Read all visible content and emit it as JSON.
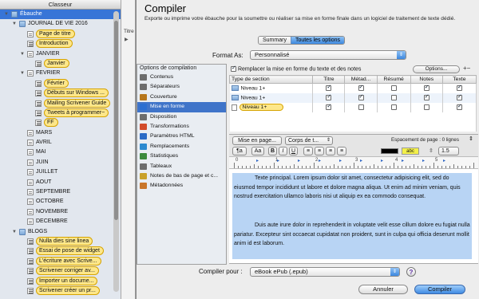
{
  "binder": {
    "header": "Classeur",
    "items": [
      {
        "label": "Ébauche",
        "level": 0,
        "icon": "folder",
        "expanded": true,
        "selected": true
      },
      {
        "label": "JOURNAL DE VIE 2016",
        "level": 1,
        "icon": "folder",
        "expanded": true
      },
      {
        "label": "Page de titre",
        "level": 2,
        "icon": "doc",
        "highlighted": true
      },
      {
        "label": "Introduction",
        "level": 2,
        "icon": "doctxt",
        "highlighted": true
      },
      {
        "label": "JANVIER",
        "level": 2,
        "icon": "doc",
        "expanded": true
      },
      {
        "label": "Janvier",
        "level": 3,
        "icon": "doctxt",
        "highlighted": true
      },
      {
        "label": "FEVRIER",
        "level": 2,
        "icon": "doc",
        "expanded": true
      },
      {
        "label": "Février",
        "level": 3,
        "icon": "doctxt",
        "highlighted": true
      },
      {
        "label": "Débuts sur Windows ...",
        "level": 3,
        "icon": "doctxt",
        "highlighted": true
      },
      {
        "label": "Mailing Scrivener Guide",
        "level": 3,
        "icon": "doctxt",
        "highlighted": true
      },
      {
        "label": "Tweets à programmer~",
        "level": 3,
        "icon": "doctxt",
        "highlighted": true
      },
      {
        "label": "FF",
        "level": 3,
        "icon": "doctxt",
        "highlighted": true
      },
      {
        "label": "MARS",
        "level": 2,
        "icon": "doc"
      },
      {
        "label": "AVRIL",
        "level": 2,
        "icon": "doc"
      },
      {
        "label": "MAI",
        "level": 2,
        "icon": "doc"
      },
      {
        "label": "JUIN",
        "level": 2,
        "icon": "doc"
      },
      {
        "label": "JUILLET",
        "level": 2,
        "icon": "doc"
      },
      {
        "label": "AOUT",
        "level": 2,
        "icon": "doc"
      },
      {
        "label": "SEPTEMBRE",
        "level": 2,
        "icon": "doc"
      },
      {
        "label": "OCTOBRE",
        "level": 2,
        "icon": "doc"
      },
      {
        "label": "NOVEMBRE",
        "level": 2,
        "icon": "doc"
      },
      {
        "label": "DECEMBRE",
        "level": 2,
        "icon": "doc"
      },
      {
        "label": "BLOGS",
        "level": 1,
        "icon": "folder",
        "expanded": true
      },
      {
        "label": "Nulla dies sine linea",
        "level": 2,
        "icon": "doctxt",
        "highlighted": true
      },
      {
        "label": "Essai de pose de widget",
        "level": 2,
        "icon": "doctxt",
        "highlighted": true
      },
      {
        "label": "L'écriture avec Scrive...",
        "level": 2,
        "icon": "doctxt",
        "highlighted": true
      },
      {
        "label": "Scrivener corriger av...",
        "level": 2,
        "icon": "doctxt",
        "highlighted": true
      },
      {
        "label": "Importer un docume...",
        "level": 2,
        "icon": "doctxt",
        "highlighted": true
      },
      {
        "label": "Scrivener créer un pr...",
        "level": 2,
        "icon": "doctxt",
        "highlighted": true
      }
    ]
  },
  "editor_strip": {
    "tab_label": "Titre"
  },
  "dialog": {
    "title": "Compiler",
    "subtitle": "Exporte ou imprime votre ébauche pour la soumettre ou réaliser sa mise en forme finale dans un logiciel de traitement de texte dédié.",
    "tabs": [
      "Summary",
      "Toutes les options"
    ],
    "active_tab": 1,
    "format_label": "Format As:",
    "format_value": "Personnalisé",
    "options_header": "Options de compilation",
    "options": [
      {
        "label": "Contenus",
        "icon": "contents-icon",
        "color": "#6d6d6d"
      },
      {
        "label": "Séparateurs",
        "icon": "separators-icon",
        "color": "#6d6d6d"
      },
      {
        "label": "Couverture",
        "icon": "cover-icon",
        "color": "#b7771c"
      },
      {
        "label": "Mise en forme",
        "icon": "formatting-icon",
        "color": "#2c6fd1",
        "selected": true
      },
      {
        "label": "Disposition",
        "icon": "layout-icon",
        "color": "#6d6d6d"
      },
      {
        "label": "Transformations",
        "icon": "transformations-icon",
        "color": "#d24b2b"
      },
      {
        "label": "Paramètres HTML",
        "icon": "html-settings-icon",
        "color": "#2b6bc6"
      },
      {
        "label": "Remplacements",
        "icon": "replacements-icon",
        "color": "#2c8ad0"
      },
      {
        "label": "Statistiques",
        "icon": "statistics-icon",
        "color": "#3c8a3c"
      },
      {
        "label": "Tableaux",
        "icon": "tables-icon",
        "color": "#6d6d6d"
      },
      {
        "label": "Notes de bas de page et c...",
        "icon": "footnotes-icon",
        "color": "#c9a12a"
      },
      {
        "label": "Métadonnées",
        "icon": "metadata-icon",
        "color": "#c9762a"
      }
    ],
    "override_label": "Remplacer la mise en forme du texte et des notes",
    "override_checked": true,
    "options_button": "Options...",
    "columns": [
      "Type de section",
      "Titre",
      "Métad...",
      "Résumé",
      "Notes",
      "Texte"
    ],
    "rows": [
      {
        "name": "Niveau  1+",
        "icon": "folder",
        "checks": [
          true,
          true,
          false,
          true,
          true
        ]
      },
      {
        "name": "Niveau  1+",
        "icon": "folder",
        "checks": [
          true,
          true,
          false,
          true,
          true
        ]
      },
      {
        "name": "Niveau  1+",
        "icon": "doc",
        "checks": [
          true,
          false,
          false,
          false,
          true
        ],
        "highlighted": true
      }
    ],
    "editor": {
      "page_button": "Mise en page...",
      "body_style": "Corps de t...",
      "page_spacing_label": "Espacement de page : 0 lignes",
      "para_style": "¶a",
      "font_size_label": "Aa",
      "bold": "B",
      "italic": "I",
      "underline": "U",
      "line_spacing": "1.5",
      "highlight_label": "abc",
      "ruler_numbers": [
        "0",
        "1",
        "2",
        "3",
        "4",
        "5"
      ],
      "paragraph1": "Texte principal. Lorem ipsum dolor sit amet, consectetur adipisicing elit, sed do eiusmod tempor incididunt ut labore et dolore magna aliqua. Ut enim ad minim veniam, quis nostrud exercitation ullamco laboris nisi ut aliquip ex ea commodo consequat.",
      "paragraph2": "Duis aute irure dolor in reprehenderit in voluptate velit esse cillum dolore eu fugiat nulla pariatur. Excepteur sint occaecat cupidatat non proident, sunt in culpa qui officia deserunt mollit anim id est laborum."
    },
    "compile_for_label": "Compiler pour :",
    "compile_for_value": "eBook ePub (.epub)",
    "cancel_button": "Annuler",
    "compile_button": "Compiler",
    "help_button": "?",
    "plus_minus": "+−"
  }
}
